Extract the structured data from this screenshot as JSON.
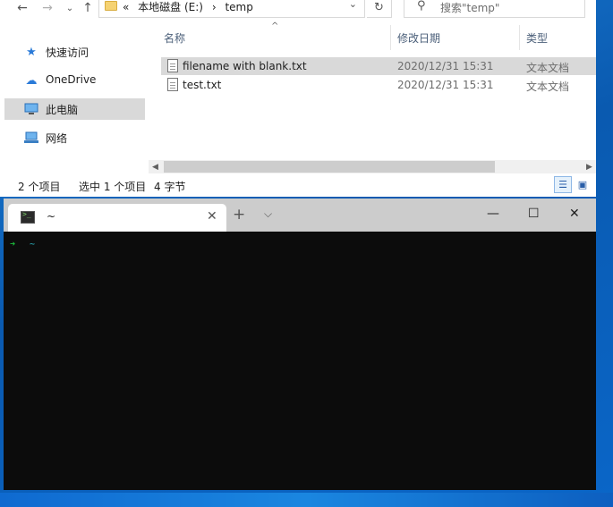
{
  "explorer": {
    "nav": {
      "back_icon": "arrow-left-icon",
      "forward_icon": "arrow-right-icon",
      "recent_icon": "chevron-down-icon",
      "up_icon": "arrow-up-icon"
    },
    "address": {
      "overflow": "«",
      "crumbs": [
        "本地磁盘 (E:)",
        "›",
        "temp"
      ]
    },
    "search_placeholder": "搜索\"temp\"",
    "sidebar": [
      {
        "label": "快速访问",
        "icon": "star-icon",
        "color": "#2a7ad8"
      },
      {
        "label": "OneDrive",
        "icon": "cloud-icon",
        "color": "#2a7ad8"
      },
      {
        "label": "此电脑",
        "icon": "computer-icon",
        "color": "#2a7ad8"
      },
      {
        "label": "网络",
        "icon": "network-icon",
        "color": "#2a7ad8"
      }
    ],
    "columns": {
      "name": "名称",
      "date": "修改日期",
      "type": "类型"
    },
    "files": [
      {
        "name": "filename with blank.txt",
        "date": "2020/12/31 15:31",
        "type": "文本文档",
        "selected": true
      },
      {
        "name": "test.txt",
        "date": "2020/12/31 15:31",
        "type": "文本文档",
        "selected": false
      }
    ],
    "status": {
      "count": "2 个项目",
      "selected": "选中 1 个项目",
      "size": "4 字节"
    }
  },
  "terminal": {
    "tab_title": "~",
    "prompt_arrow": "➜",
    "prompt_dir": "~",
    "colors": {
      "background": "#0c0c0c",
      "arrow": "#1cbc3c",
      "dir": "#2fbdcb"
    }
  }
}
